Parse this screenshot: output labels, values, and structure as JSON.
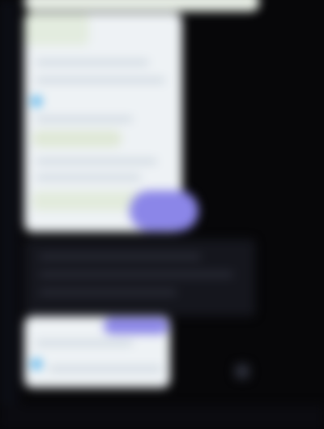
{
  "screen": {
    "title": "",
    "messages": [
      {
        "id": "m1",
        "text": ""
      },
      {
        "id": "m2",
        "text": ""
      },
      {
        "id": "m3",
        "text": ""
      },
      {
        "id": "m4",
        "text": ""
      },
      {
        "id": "m5",
        "text": ""
      }
    ],
    "composer": {
      "placeholder": ""
    }
  },
  "colors": {
    "background": "#070709",
    "bubble": "#eef2f5",
    "accent": "#8b86e8",
    "badge": "#5fb7ec",
    "panel": "#15161d"
  },
  "icons": [
    "avatar-badge-icon",
    "send-icon"
  ]
}
